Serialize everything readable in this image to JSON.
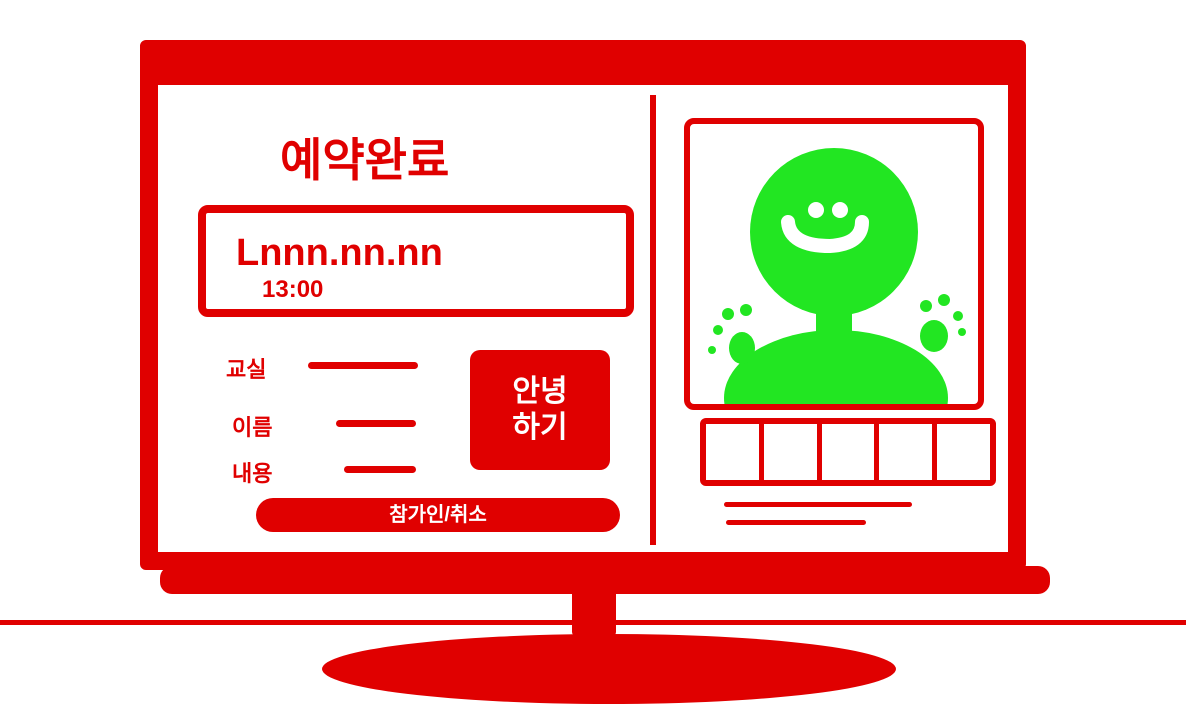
{
  "title": "예약완료",
  "booking": {
    "date": "Lnnn.nn.nn",
    "time": "13:00"
  },
  "info": {
    "labels": [
      "교실",
      "이름",
      "내용"
    ]
  },
  "action_button": {
    "line1": "안녕",
    "line2": "하기"
  },
  "bottom_bar": {
    "label": "참가인/취소"
  },
  "colors": {
    "accent": "#e00000",
    "avatar": "#22e622",
    "background": "#ffffff"
  },
  "icons": {
    "video_avatar": "smiling-avatar-icon",
    "paws": "paw-print-icon"
  }
}
